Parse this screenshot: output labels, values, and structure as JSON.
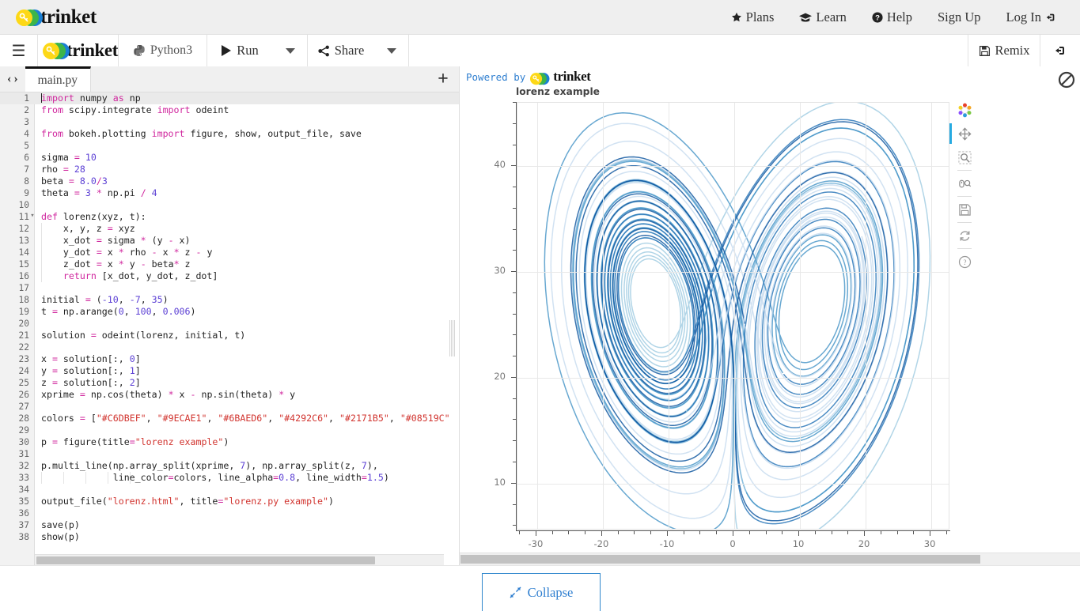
{
  "site_header": {
    "logo_text": "trinket",
    "nav": [
      {
        "label": "Plans",
        "icon": "star-icon"
      },
      {
        "label": "Learn",
        "icon": "graduation-cap-icon"
      },
      {
        "label": "Help",
        "icon": "question-circle-icon"
      },
      {
        "label": "Sign Up",
        "icon": "none"
      },
      {
        "label": "Log In",
        "icon": "login-icon"
      }
    ]
  },
  "toolbar": {
    "menu_icon": "hamburger-icon",
    "logo_text": "trinket",
    "language": "Python3",
    "language_icon": "python-icon",
    "run_label": "Run",
    "run_icon": "play-icon",
    "share_label": "Share",
    "share_icon": "share-nodes-icon",
    "remix_label": "Remix",
    "remix_icon": "floppy-disk-icon",
    "login_icon": "login-icon"
  },
  "tabbar": {
    "nav_prev": "‹",
    "nav_next": "›",
    "active_tab": "main.py",
    "add_label": "+"
  },
  "editor": {
    "lines": [
      {
        "n": 1,
        "active": true,
        "tokens": [
          {
            "t": "|",
            "c": "cursor"
          },
          {
            "t": "import",
            "c": "kw"
          },
          {
            "t": " numpy ",
            "c": ""
          },
          {
            "t": "as",
            "c": "kw"
          },
          {
            "t": " np",
            "c": ""
          }
        ]
      },
      {
        "n": 2,
        "tokens": [
          {
            "t": "from",
            "c": "kw"
          },
          {
            "t": " scipy.integrate ",
            "c": ""
          },
          {
            "t": "import",
            "c": "kw"
          },
          {
            "t": " odeint",
            "c": ""
          }
        ]
      },
      {
        "n": 3,
        "tokens": []
      },
      {
        "n": 4,
        "tokens": [
          {
            "t": "from",
            "c": "kw"
          },
          {
            "t": " bokeh.plotting ",
            "c": ""
          },
          {
            "t": "import",
            "c": "kw"
          },
          {
            "t": " figure, show, output_file, save",
            "c": ""
          }
        ]
      },
      {
        "n": 5,
        "tokens": []
      },
      {
        "n": 6,
        "tokens": [
          {
            "t": "sigma ",
            "c": ""
          },
          {
            "t": "=",
            "c": "op"
          },
          {
            "t": " ",
            "c": ""
          },
          {
            "t": "10",
            "c": "num"
          }
        ]
      },
      {
        "n": 7,
        "tokens": [
          {
            "t": "rho ",
            "c": ""
          },
          {
            "t": "=",
            "c": "op"
          },
          {
            "t": " ",
            "c": ""
          },
          {
            "t": "28",
            "c": "num"
          }
        ]
      },
      {
        "n": 8,
        "tokens": [
          {
            "t": "beta ",
            "c": ""
          },
          {
            "t": "=",
            "c": "op"
          },
          {
            "t": " ",
            "c": ""
          },
          {
            "t": "8.0",
            "c": "num"
          },
          {
            "t": "/",
            "c": "op"
          },
          {
            "t": "3",
            "c": "num"
          }
        ]
      },
      {
        "n": 9,
        "tokens": [
          {
            "t": "theta ",
            "c": ""
          },
          {
            "t": "=",
            "c": "op"
          },
          {
            "t": " ",
            "c": ""
          },
          {
            "t": "3",
            "c": "num"
          },
          {
            "t": " ",
            "c": ""
          },
          {
            "t": "*",
            "c": "op"
          },
          {
            "t": " np.pi ",
            "c": ""
          },
          {
            "t": "/",
            "c": "op"
          },
          {
            "t": " ",
            "c": ""
          },
          {
            "t": "4",
            "c": "num"
          }
        ]
      },
      {
        "n": 10,
        "tokens": []
      },
      {
        "n": 11,
        "fold": "▾",
        "tokens": [
          {
            "t": "def",
            "c": "kw"
          },
          {
            "t": " lorenz(xyz, t):",
            "c": ""
          }
        ]
      },
      {
        "n": 12,
        "indent": 1,
        "tokens": [
          {
            "t": "    x, y, z ",
            "c": ""
          },
          {
            "t": "=",
            "c": "op"
          },
          {
            "t": " xyz",
            "c": ""
          }
        ]
      },
      {
        "n": 13,
        "indent": 1,
        "tokens": [
          {
            "t": "    x_dot ",
            "c": ""
          },
          {
            "t": "=",
            "c": "op"
          },
          {
            "t": " sigma ",
            "c": ""
          },
          {
            "t": "*",
            "c": "op"
          },
          {
            "t": " (y ",
            "c": ""
          },
          {
            "t": "-",
            "c": "op"
          },
          {
            "t": " x)",
            "c": ""
          }
        ]
      },
      {
        "n": 14,
        "indent": 1,
        "tokens": [
          {
            "t": "    y_dot ",
            "c": ""
          },
          {
            "t": "=",
            "c": "op"
          },
          {
            "t": " x ",
            "c": ""
          },
          {
            "t": "*",
            "c": "op"
          },
          {
            "t": " rho ",
            "c": ""
          },
          {
            "t": "-",
            "c": "op"
          },
          {
            "t": " x ",
            "c": ""
          },
          {
            "t": "*",
            "c": "op"
          },
          {
            "t": " z ",
            "c": ""
          },
          {
            "t": "-",
            "c": "op"
          },
          {
            "t": " y",
            "c": ""
          }
        ]
      },
      {
        "n": 15,
        "indent": 1,
        "tokens": [
          {
            "t": "    z_dot ",
            "c": ""
          },
          {
            "t": "=",
            "c": "op"
          },
          {
            "t": " x ",
            "c": ""
          },
          {
            "t": "*",
            "c": "op"
          },
          {
            "t": " y ",
            "c": ""
          },
          {
            "t": "-",
            "c": "op"
          },
          {
            "t": " beta",
            "c": ""
          },
          {
            "t": "*",
            "c": "op"
          },
          {
            "t": " z",
            "c": ""
          }
        ]
      },
      {
        "n": 16,
        "indent": 1,
        "tokens": [
          {
            "t": "    ",
            "c": ""
          },
          {
            "t": "return",
            "c": "kw"
          },
          {
            "t": " [x_dot, y_dot, z_dot]",
            "c": ""
          }
        ]
      },
      {
        "n": 17,
        "tokens": []
      },
      {
        "n": 18,
        "tokens": [
          {
            "t": "initial ",
            "c": ""
          },
          {
            "t": "=",
            "c": "op"
          },
          {
            "t": " (",
            "c": ""
          },
          {
            "t": "-10",
            "c": "num"
          },
          {
            "t": ", ",
            "c": ""
          },
          {
            "t": "-7",
            "c": "num"
          },
          {
            "t": ", ",
            "c": ""
          },
          {
            "t": "35",
            "c": "num"
          },
          {
            "t": ")",
            "c": ""
          }
        ]
      },
      {
        "n": 19,
        "tokens": [
          {
            "t": "t ",
            "c": ""
          },
          {
            "t": "=",
            "c": "op"
          },
          {
            "t": " np.arange(",
            "c": ""
          },
          {
            "t": "0",
            "c": "num"
          },
          {
            "t": ", ",
            "c": ""
          },
          {
            "t": "100",
            "c": "num"
          },
          {
            "t": ", ",
            "c": ""
          },
          {
            "t": "0.006",
            "c": "num"
          },
          {
            "t": ")",
            "c": ""
          }
        ]
      },
      {
        "n": 20,
        "tokens": []
      },
      {
        "n": 21,
        "tokens": [
          {
            "t": "solution ",
            "c": ""
          },
          {
            "t": "=",
            "c": "op"
          },
          {
            "t": " odeint(lorenz, initial, t)",
            "c": ""
          }
        ]
      },
      {
        "n": 22,
        "tokens": []
      },
      {
        "n": 23,
        "tokens": [
          {
            "t": "x ",
            "c": ""
          },
          {
            "t": "=",
            "c": "op"
          },
          {
            "t": " solution[:, ",
            "c": ""
          },
          {
            "t": "0",
            "c": "num"
          },
          {
            "t": "]",
            "c": ""
          }
        ]
      },
      {
        "n": 24,
        "tokens": [
          {
            "t": "y ",
            "c": ""
          },
          {
            "t": "=",
            "c": "op"
          },
          {
            "t": " solution[:, ",
            "c": ""
          },
          {
            "t": "1",
            "c": "num"
          },
          {
            "t": "]",
            "c": ""
          }
        ]
      },
      {
        "n": 25,
        "tokens": [
          {
            "t": "z ",
            "c": ""
          },
          {
            "t": "=",
            "c": "op"
          },
          {
            "t": " solution[:, ",
            "c": ""
          },
          {
            "t": "2",
            "c": "num"
          },
          {
            "t": "]",
            "c": ""
          }
        ]
      },
      {
        "n": 26,
        "tokens": [
          {
            "t": "xprime ",
            "c": ""
          },
          {
            "t": "=",
            "c": "op"
          },
          {
            "t": " np.cos(theta) ",
            "c": ""
          },
          {
            "t": "*",
            "c": "op"
          },
          {
            "t": " x ",
            "c": ""
          },
          {
            "t": "-",
            "c": "op"
          },
          {
            "t": " np.sin(theta) ",
            "c": ""
          },
          {
            "t": "*",
            "c": "op"
          },
          {
            "t": " y",
            "c": ""
          }
        ]
      },
      {
        "n": 27,
        "tokens": []
      },
      {
        "n": 28,
        "tokens": [
          {
            "t": "colors ",
            "c": ""
          },
          {
            "t": "=",
            "c": "op"
          },
          {
            "t": " [",
            "c": ""
          },
          {
            "t": "\"#C6DBEF\"",
            "c": "str"
          },
          {
            "t": ", ",
            "c": ""
          },
          {
            "t": "\"#9ECAE1\"",
            "c": "str"
          },
          {
            "t": ", ",
            "c": ""
          },
          {
            "t": "\"#6BAED6\"",
            "c": "str"
          },
          {
            "t": ", ",
            "c": ""
          },
          {
            "t": "\"#4292C6\"",
            "c": "str"
          },
          {
            "t": ", ",
            "c": ""
          },
          {
            "t": "\"#2171B5\"",
            "c": "str"
          },
          {
            "t": ", ",
            "c": ""
          },
          {
            "t": "\"#08519C\"",
            "c": "str"
          }
        ]
      },
      {
        "n": 29,
        "tokens": []
      },
      {
        "n": 30,
        "tokens": [
          {
            "t": "p ",
            "c": ""
          },
          {
            "t": "=",
            "c": "op"
          },
          {
            "t": " figure(title",
            "c": ""
          },
          {
            "t": "=",
            "c": "op"
          },
          {
            "t": "\"lorenz example\"",
            "c": "str"
          },
          {
            "t": ")",
            "c": ""
          }
        ]
      },
      {
        "n": 31,
        "tokens": []
      },
      {
        "n": 32,
        "tokens": [
          {
            "t": "p.multi_line(np.array_split(xprime, ",
            "c": ""
          },
          {
            "t": "7",
            "c": "num"
          },
          {
            "t": "), np.array_split(z, ",
            "c": ""
          },
          {
            "t": "7",
            "c": "num"
          },
          {
            "t": "),",
            "c": ""
          }
        ]
      },
      {
        "n": 33,
        "indent": 5,
        "tokens": [
          {
            "t": "             line_color",
            "c": ""
          },
          {
            "t": "=",
            "c": "op"
          },
          {
            "t": "colors, line_alpha",
            "c": ""
          },
          {
            "t": "=",
            "c": "op"
          },
          {
            "t": "0.8",
            "c": "num"
          },
          {
            "t": ", line_width",
            "c": ""
          },
          {
            "t": "=",
            "c": "op"
          },
          {
            "t": "1.5",
            "c": "num"
          },
          {
            "t": ")",
            "c": ""
          }
        ]
      },
      {
        "n": 34,
        "tokens": []
      },
      {
        "n": 35,
        "tokens": [
          {
            "t": "output_file(",
            "c": ""
          },
          {
            "t": "\"lorenz.html\"",
            "c": "str"
          },
          {
            "t": ", title",
            "c": ""
          },
          {
            "t": "=",
            "c": "op"
          },
          {
            "t": "\"lorenz.py example\"",
            "c": "str"
          },
          {
            "t": ")",
            "c": ""
          }
        ]
      },
      {
        "n": 36,
        "tokens": []
      },
      {
        "n": 37,
        "tokens": [
          {
            "t": "save(p)",
            "c": ""
          }
        ]
      },
      {
        "n": 38,
        "tokens": [
          {
            "t": "show(p)",
            "c": ""
          }
        ]
      }
    ]
  },
  "preview": {
    "powered_by": "Powered by",
    "powered_logo": "trinket",
    "block_icon": "no-entry-icon",
    "bokeh_tools": [
      {
        "name": "bokeh-logo-icon",
        "active": false
      },
      {
        "name": "pan-tool-icon",
        "active": true
      },
      {
        "name": "box-zoom-tool-icon",
        "active": false
      },
      {
        "name": "wheel-zoom-tool-icon",
        "active": false
      },
      {
        "name": "save-tool-icon",
        "active": false
      },
      {
        "name": "reset-tool-icon",
        "active": false
      },
      {
        "name": "help-tool-icon",
        "active": false
      }
    ]
  },
  "chart_data": {
    "type": "line",
    "title": "lorenz example",
    "xlabel": "",
    "ylabel": "",
    "xlim": [
      -33,
      33
    ],
    "ylim": [
      5.5,
      46
    ],
    "xticks": [
      -30,
      -20,
      -10,
      0,
      10,
      20,
      30
    ],
    "yticks": [
      10,
      20,
      30,
      40
    ],
    "x_minor_step": 2.5,
    "y_minor_step": 2,
    "grid": true,
    "legend": "none",
    "description": "Lorenz attractor projection (xprime vs z) drawn as 7 multi_line segments",
    "series_colors": [
      "#C6DBEF",
      "#9ECAE1",
      "#6BAED6",
      "#4292C6",
      "#2171B5",
      "#08519C"
    ],
    "line_alpha": 0.8,
    "line_width": 1.5,
    "n_segments": 7,
    "params": {
      "sigma": 10,
      "rho": 28,
      "beta": 2.6667,
      "theta": 2.356,
      "initial": [
        -10,
        -7,
        35
      ],
      "t_start": 0,
      "t_end": 100,
      "dt": 0.006
    }
  },
  "bottom": {
    "collapse_label": "Collapse",
    "collapse_icon": "collapse-arrows-icon"
  }
}
